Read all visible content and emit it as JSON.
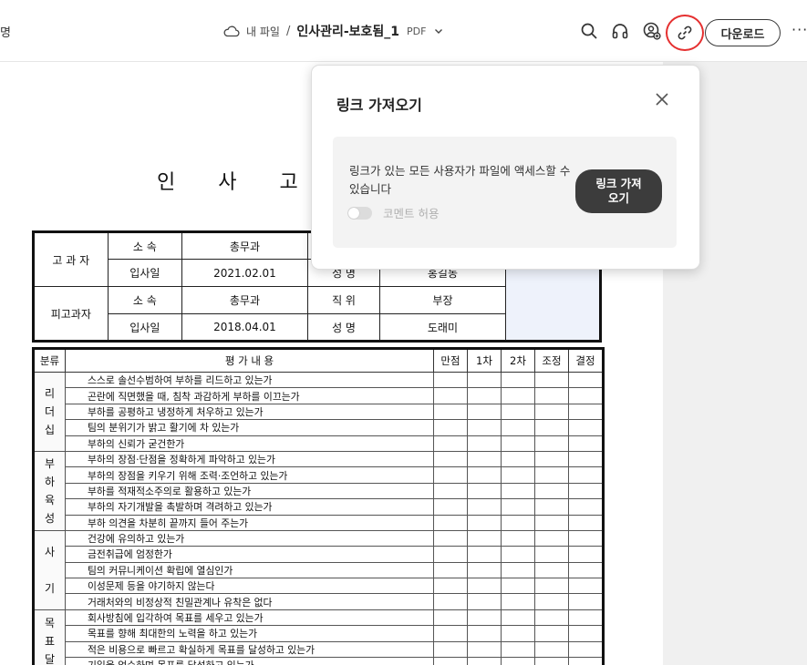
{
  "topbar": {
    "left_fragment": "명",
    "breadcrumb_root": "내 파일",
    "separator": "/",
    "file_name": "인사관리-보호됨_1",
    "file_type": "PDF",
    "download_label": "다운로드",
    "more_label": "···",
    "highlight_color": "#e53030"
  },
  "document": {
    "title": "인 사 고 과",
    "info": {
      "rater_label": "고 과 자",
      "ratee_label": "피고과자",
      "dept_label": "소  속",
      "join_label": "입사일",
      "position_label": "직  위",
      "name_label": "성  명",
      "rater_dept": "총무과",
      "rater_join": "2021.02.01",
      "rater_name": "홍길동",
      "ratee_dept": "총무과",
      "ratee_join": "2018.04.01",
      "ratee_position": "부장",
      "ratee_name": "도래미"
    },
    "eval_headers": {
      "category": "분류",
      "content": "평    가    내    용",
      "full": "만점",
      "first": "1차",
      "second": "2차",
      "adjust": "조정",
      "decision": "결정"
    },
    "categories": [
      {
        "label": "리\n더\n십",
        "items": [
          "스스로 솔선수범하여 부하를 리드하고 있는가",
          "곤란에 직면했을 때, 침착 과감하게 부하를 이끄는가",
          "부하를 공평하고 냉정하게 처우하고 있는가",
          "팀의 분위기가 밝고 활기에 차 있는가",
          "부하의 신뢰가 굳건한가"
        ]
      },
      {
        "label": "부\n하\n육\n성",
        "items": [
          "부하의 장점·단점을 정확하게 파악하고 있는가",
          "부하의 장점을 키우기 위해 조력·조언하고 있는가",
          "부하를 적재적소주의로 활용하고 있는가",
          "부하의 자기개발을 촉발하며 격려하고 있는가",
          "부하 의견을 차분히 끝까지 들어 주는가"
        ]
      },
      {
        "label": "사\n\n기",
        "items": [
          "건강에 유의하고 있는가",
          "금전취급에 엄정한가",
          "팀의 커뮤니케이션 확립에 열심인가",
          "이성문제 등을 야기하지 않는다",
          "거래처와의 비정상적 친밀관계나 유착은 없다"
        ]
      },
      {
        "label": "목\n표\n달",
        "items": [
          "회사방침에 입각하여 목표를 세우고 있는가",
          "목표를 향해 최대한의 노력을 하고 있는가",
          "적은 비용으로 빠르고 확실하게 목표를 달성하고 있는가",
          "기일을 엄수하며 목표를 달성하고 있는가"
        ]
      }
    ]
  },
  "popup": {
    "title": "링크 가져오기",
    "description": "링크가 있는 모든 사용자가 파일에 액세스할 수 있습니다",
    "toggle_label": "코멘트 허용",
    "toggle_on": false,
    "button_label": "링크 가져\n오기"
  }
}
